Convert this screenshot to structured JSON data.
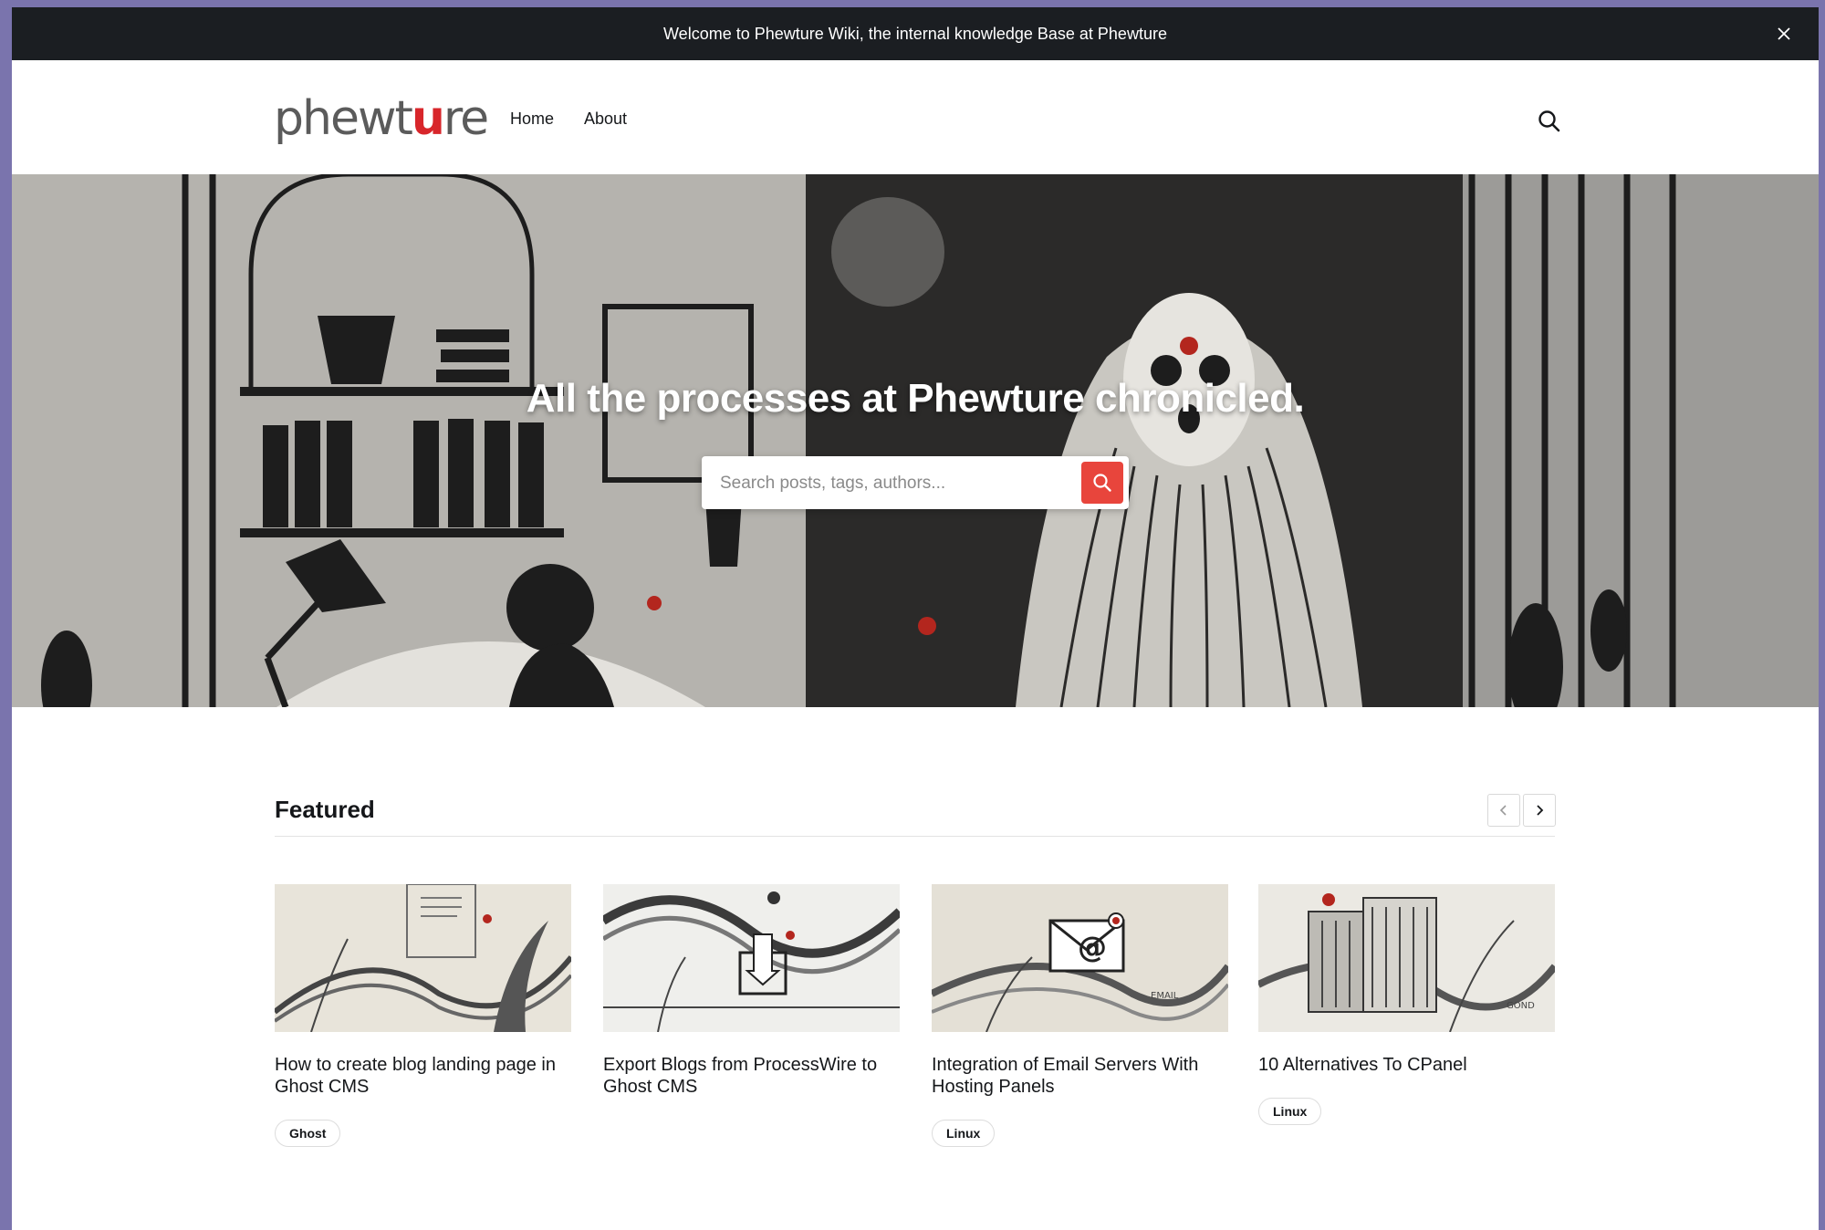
{
  "announcement": {
    "text": "Welcome to Phewture Wiki, the internal knowledge Base at Phewture",
    "close_icon": "close-icon"
  },
  "header": {
    "logo_prefix": "phewt",
    "logo_mark": "u",
    "logo_suffix": "re",
    "nav": [
      {
        "label": "Home"
      },
      {
        "label": "About"
      }
    ],
    "search_icon": "search-icon"
  },
  "hero": {
    "title": "All the processes at Phewture chronicled.",
    "search_placeholder": "Search posts, tags, authors...",
    "search_button_icon": "search-icon"
  },
  "featured": {
    "heading": "Featured",
    "prev_icon": "chevron-left-icon",
    "next_icon": "chevron-right-icon",
    "cards": [
      {
        "title": "How to create blog landing page in Ghost CMS",
        "tag": "Ghost"
      },
      {
        "title": "Export Blogs from ProcessWire to Ghost CMS",
        "tag": ""
      },
      {
        "title": "Integration of Email Servers With Hosting Panels",
        "tag": "Linux"
      },
      {
        "title": "10 Alternatives To CPanel",
        "tag": "Linux"
      }
    ]
  },
  "colors": {
    "accent": "#e8453c",
    "logo_red": "#d8262b",
    "announce_bg": "#1b1e22",
    "text": "#15171a"
  }
}
